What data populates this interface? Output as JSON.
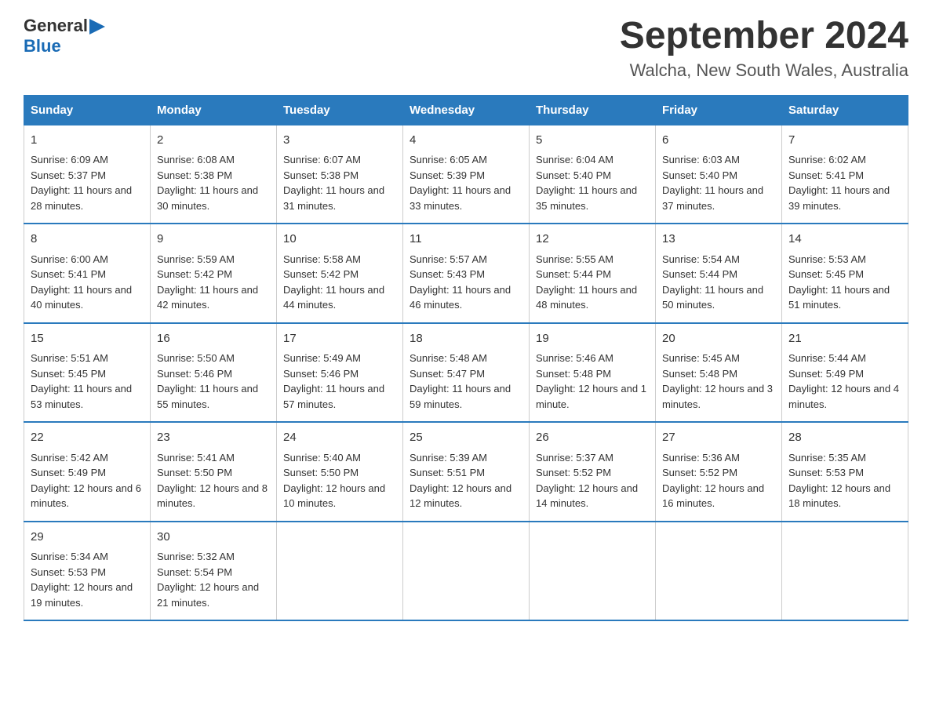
{
  "logo": {
    "text_general": "General",
    "arrow": "▶",
    "text_blue": "Blue"
  },
  "title": "September 2024",
  "subtitle": "Walcha, New South Wales, Australia",
  "days_of_week": [
    "Sunday",
    "Monday",
    "Tuesday",
    "Wednesday",
    "Thursday",
    "Friday",
    "Saturday"
  ],
  "weeks": [
    [
      {
        "day": "1",
        "sunrise": "Sunrise: 6:09 AM",
        "sunset": "Sunset: 5:37 PM",
        "daylight": "Daylight: 11 hours and 28 minutes."
      },
      {
        "day": "2",
        "sunrise": "Sunrise: 6:08 AM",
        "sunset": "Sunset: 5:38 PM",
        "daylight": "Daylight: 11 hours and 30 minutes."
      },
      {
        "day": "3",
        "sunrise": "Sunrise: 6:07 AM",
        "sunset": "Sunset: 5:38 PM",
        "daylight": "Daylight: 11 hours and 31 minutes."
      },
      {
        "day": "4",
        "sunrise": "Sunrise: 6:05 AM",
        "sunset": "Sunset: 5:39 PM",
        "daylight": "Daylight: 11 hours and 33 minutes."
      },
      {
        "day": "5",
        "sunrise": "Sunrise: 6:04 AM",
        "sunset": "Sunset: 5:40 PM",
        "daylight": "Daylight: 11 hours and 35 minutes."
      },
      {
        "day": "6",
        "sunrise": "Sunrise: 6:03 AM",
        "sunset": "Sunset: 5:40 PM",
        "daylight": "Daylight: 11 hours and 37 minutes."
      },
      {
        "day": "7",
        "sunrise": "Sunrise: 6:02 AM",
        "sunset": "Sunset: 5:41 PM",
        "daylight": "Daylight: 11 hours and 39 minutes."
      }
    ],
    [
      {
        "day": "8",
        "sunrise": "Sunrise: 6:00 AM",
        "sunset": "Sunset: 5:41 PM",
        "daylight": "Daylight: 11 hours and 40 minutes."
      },
      {
        "day": "9",
        "sunrise": "Sunrise: 5:59 AM",
        "sunset": "Sunset: 5:42 PM",
        "daylight": "Daylight: 11 hours and 42 minutes."
      },
      {
        "day": "10",
        "sunrise": "Sunrise: 5:58 AM",
        "sunset": "Sunset: 5:42 PM",
        "daylight": "Daylight: 11 hours and 44 minutes."
      },
      {
        "day": "11",
        "sunrise": "Sunrise: 5:57 AM",
        "sunset": "Sunset: 5:43 PM",
        "daylight": "Daylight: 11 hours and 46 minutes."
      },
      {
        "day": "12",
        "sunrise": "Sunrise: 5:55 AM",
        "sunset": "Sunset: 5:44 PM",
        "daylight": "Daylight: 11 hours and 48 minutes."
      },
      {
        "day": "13",
        "sunrise": "Sunrise: 5:54 AM",
        "sunset": "Sunset: 5:44 PM",
        "daylight": "Daylight: 11 hours and 50 minutes."
      },
      {
        "day": "14",
        "sunrise": "Sunrise: 5:53 AM",
        "sunset": "Sunset: 5:45 PM",
        "daylight": "Daylight: 11 hours and 51 minutes."
      }
    ],
    [
      {
        "day": "15",
        "sunrise": "Sunrise: 5:51 AM",
        "sunset": "Sunset: 5:45 PM",
        "daylight": "Daylight: 11 hours and 53 minutes."
      },
      {
        "day": "16",
        "sunrise": "Sunrise: 5:50 AM",
        "sunset": "Sunset: 5:46 PM",
        "daylight": "Daylight: 11 hours and 55 minutes."
      },
      {
        "day": "17",
        "sunrise": "Sunrise: 5:49 AM",
        "sunset": "Sunset: 5:46 PM",
        "daylight": "Daylight: 11 hours and 57 minutes."
      },
      {
        "day": "18",
        "sunrise": "Sunrise: 5:48 AM",
        "sunset": "Sunset: 5:47 PM",
        "daylight": "Daylight: 11 hours and 59 minutes."
      },
      {
        "day": "19",
        "sunrise": "Sunrise: 5:46 AM",
        "sunset": "Sunset: 5:48 PM",
        "daylight": "Daylight: 12 hours and 1 minute."
      },
      {
        "day": "20",
        "sunrise": "Sunrise: 5:45 AM",
        "sunset": "Sunset: 5:48 PM",
        "daylight": "Daylight: 12 hours and 3 minutes."
      },
      {
        "day": "21",
        "sunrise": "Sunrise: 5:44 AM",
        "sunset": "Sunset: 5:49 PM",
        "daylight": "Daylight: 12 hours and 4 minutes."
      }
    ],
    [
      {
        "day": "22",
        "sunrise": "Sunrise: 5:42 AM",
        "sunset": "Sunset: 5:49 PM",
        "daylight": "Daylight: 12 hours and 6 minutes."
      },
      {
        "day": "23",
        "sunrise": "Sunrise: 5:41 AM",
        "sunset": "Sunset: 5:50 PM",
        "daylight": "Daylight: 12 hours and 8 minutes."
      },
      {
        "day": "24",
        "sunrise": "Sunrise: 5:40 AM",
        "sunset": "Sunset: 5:50 PM",
        "daylight": "Daylight: 12 hours and 10 minutes."
      },
      {
        "day": "25",
        "sunrise": "Sunrise: 5:39 AM",
        "sunset": "Sunset: 5:51 PM",
        "daylight": "Daylight: 12 hours and 12 minutes."
      },
      {
        "day": "26",
        "sunrise": "Sunrise: 5:37 AM",
        "sunset": "Sunset: 5:52 PM",
        "daylight": "Daylight: 12 hours and 14 minutes."
      },
      {
        "day": "27",
        "sunrise": "Sunrise: 5:36 AM",
        "sunset": "Sunset: 5:52 PM",
        "daylight": "Daylight: 12 hours and 16 minutes."
      },
      {
        "day": "28",
        "sunrise": "Sunrise: 5:35 AM",
        "sunset": "Sunset: 5:53 PM",
        "daylight": "Daylight: 12 hours and 18 minutes."
      }
    ],
    [
      {
        "day": "29",
        "sunrise": "Sunrise: 5:34 AM",
        "sunset": "Sunset: 5:53 PM",
        "daylight": "Daylight: 12 hours and 19 minutes."
      },
      {
        "day": "30",
        "sunrise": "Sunrise: 5:32 AM",
        "sunset": "Sunset: 5:54 PM",
        "daylight": "Daylight: 12 hours and 21 minutes."
      },
      null,
      null,
      null,
      null,
      null
    ]
  ]
}
